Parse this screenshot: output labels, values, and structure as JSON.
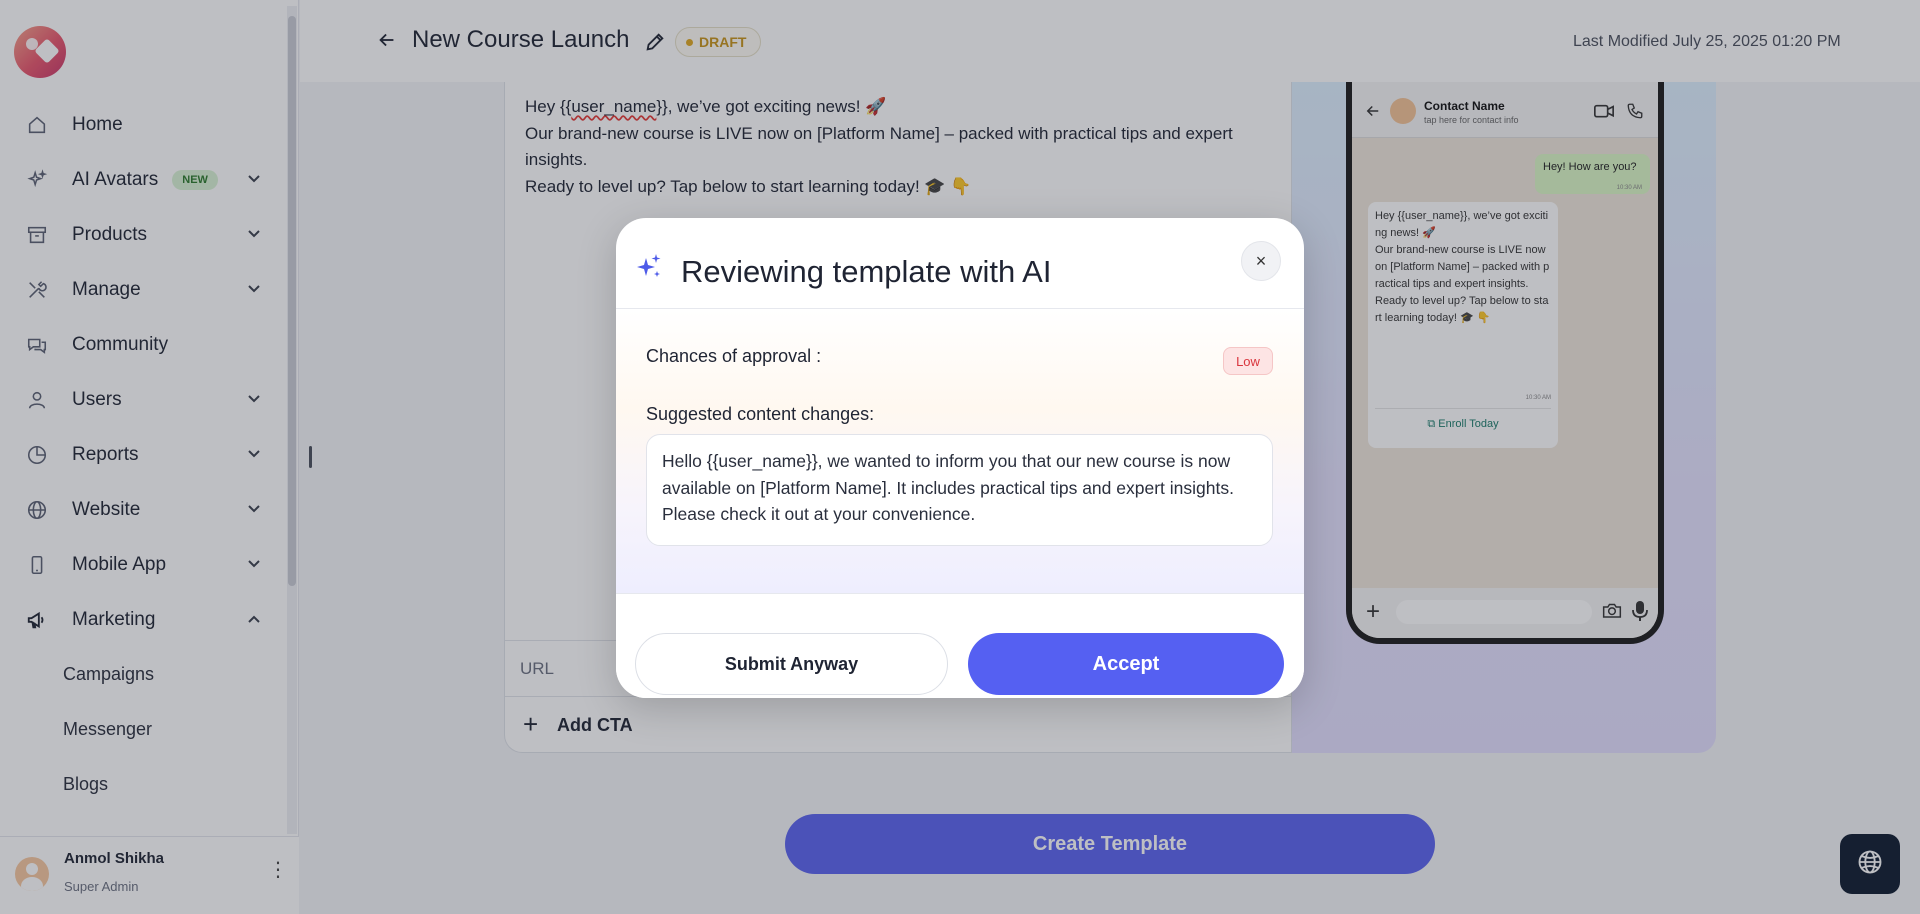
{
  "sidebar": {
    "items": [
      {
        "label": "Home",
        "icon": "home-icon"
      },
      {
        "label": "AI Avatars",
        "icon": "sparkle-icon",
        "badge": "NEW"
      },
      {
        "label": "Products",
        "icon": "archive-icon"
      },
      {
        "label": "Manage",
        "icon": "tools-icon"
      },
      {
        "label": "Community",
        "icon": "chat-icon"
      },
      {
        "label": "Users",
        "icon": "user-icon"
      },
      {
        "label": "Reports",
        "icon": "pie-chart-icon"
      },
      {
        "label": "Website",
        "icon": "globe-icon"
      },
      {
        "label": "Mobile App",
        "icon": "mobile-icon"
      },
      {
        "label": "Marketing",
        "icon": "megaphone-icon"
      }
    ],
    "sub_items": [
      "Campaigns",
      "Messenger",
      "Blogs"
    ],
    "user": {
      "name": "Anmol Shikha",
      "role": "Super Admin"
    }
  },
  "header": {
    "title": "New Course Launch",
    "status": "DRAFT",
    "last_modified": "Last Modified July 25, 2025 01:20 PM"
  },
  "editor": {
    "message_pre": "Hey {{",
    "message_var": "user_name",
    "message_post": "}}, we’ve got exciting news! 🚀",
    "line2": "Our brand-new course is LIVE now on [Platform Name] – packed with practical tips and expert insights.",
    "line3": "Ready to level up? Tap below to start learning today! 🎓 👇",
    "url_label": "URL",
    "add_cta": "Add CTA"
  },
  "preview": {
    "contact_name": "Contact Name",
    "contact_sub": "tap here for contact info",
    "outgoing": "Hey! How are you?",
    "outgoing_time": "10:30 AM",
    "incoming": "Hey {{user_name}}, we’ve got exciting news! 🚀\nOur brand-new course is LIVE now on [Platform Name] – packed with practical tips and expert insights.\nReady to level up? Tap below to start learning today! 🎓 👇",
    "incoming_time": "10:30 AM",
    "cta": "Enroll Today"
  },
  "create_button": "Create Template",
  "modal": {
    "title": "Reviewing template with AI",
    "approval_label": "Chances of approval :",
    "approval_value": "Low",
    "suggest_label": "Suggested content changes:",
    "suggestion": "Hello {{user_name}}, we wanted to inform you that our new course is now available on [Platform Name]. It includes practical tips and expert insights. Please check it out at your convenience.",
    "submit_label": "Submit Anyway",
    "accept_label": "Accept",
    "close_glyph": "×"
  },
  "colors": {
    "accent": "#5560f2",
    "draft": "#c79419",
    "low": "#d9363e",
    "badge_new_bg": "#d9f3d4"
  }
}
